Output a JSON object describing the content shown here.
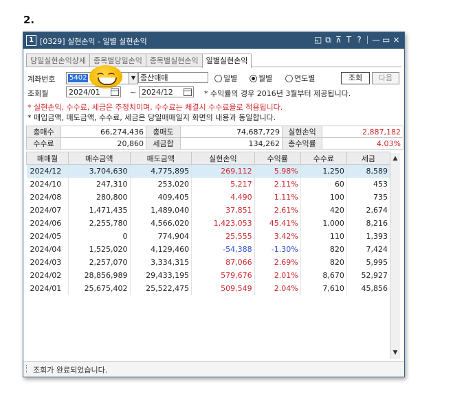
{
  "step_label": "2.",
  "window": {
    "number": "1",
    "title": "[0329] 실현손익 - 일별 실현손익",
    "icons": [
      "restore-icon",
      "copy-icon",
      "pin-icon",
      "font-icon",
      "help-icon",
      "minimize-icon",
      "maximize-icon",
      "close-icon"
    ],
    "icon_glyphs": {
      "restore": "◱",
      "copy": "⧉",
      "pin": "⊼",
      "font": "T",
      "help": "?",
      "minimize": "—",
      "maximize": "▭",
      "close": "×"
    }
  },
  "tabs": [
    {
      "label": "당일실현손익상세",
      "active": false
    },
    {
      "label": "종목별당일손익",
      "active": false
    },
    {
      "label": "종목별실현손익",
      "active": false
    },
    {
      "label": "일별실현손익",
      "active": true
    }
  ],
  "form": {
    "account_label": "계좌번호",
    "account_value": "5402",
    "account_name": "종산매매",
    "radios": [
      {
        "label": "일별",
        "checked": false
      },
      {
        "label": "월별",
        "checked": true
      },
      {
        "label": "연도별",
        "checked": false
      }
    ],
    "search_button": "조회",
    "next_button": "다음",
    "period_label": "조회월",
    "from_date": "2024/01",
    "tilde": "~",
    "to_date": "2024/12",
    "period_note": "* 수익률의 경우 2016년 3월부터 제공됩니다."
  },
  "notices": [
    "* 실현손익, 수수료, 세금은 추정치이며, 수수료는 체결시 수수료율로 적용됩니다.",
    "* 매입금액, 매도금액, 수수료, 세금은 당일매매일지 화면의 내용과 동일합니다."
  ],
  "summary": {
    "row1": [
      {
        "k": "총매수",
        "v": "66,274,436"
      },
      {
        "k": "총매도",
        "v": "74,687,729"
      },
      {
        "k": "실현손익",
        "v": "2,887,182",
        "color": "red"
      }
    ],
    "row2": [
      {
        "k": "수수료",
        "v": "20,860"
      },
      {
        "k": "세금합",
        "v": "134,262"
      },
      {
        "k": "총수익률",
        "v": "4.03%",
        "color": "red"
      }
    ]
  },
  "table": {
    "headers": [
      "매매월",
      "매수금액",
      "매도금액",
      "실현손익",
      "수익률",
      "수수료",
      "세금"
    ],
    "rows": [
      {
        "month": "2024/12",
        "buy": "3,704,630",
        "sell": "4,775,895",
        "pnl": "269,112",
        "rate": "5.98%",
        "fee": "1,250",
        "tax": "8,589",
        "sign": "pos",
        "selected": true
      },
      {
        "month": "2024/10",
        "buy": "247,310",
        "sell": "253,020",
        "pnl": "5,217",
        "rate": "2.11%",
        "fee": "60",
        "tax": "453",
        "sign": "pos"
      },
      {
        "month": "2024/08",
        "buy": "280,800",
        "sell": "409,405",
        "pnl": "4,490",
        "rate": "1.11%",
        "fee": "100",
        "tax": "735",
        "sign": "pos"
      },
      {
        "month": "2024/07",
        "buy": "1,471,435",
        "sell": "1,489,040",
        "pnl": "37,851",
        "rate": "2.61%",
        "fee": "420",
        "tax": "2,674",
        "sign": "pos"
      },
      {
        "month": "2024/06",
        "buy": "2,255,780",
        "sell": "4,566,020",
        "pnl": "1,423,053",
        "rate": "45.41%",
        "fee": "1,000",
        "tax": "8,216",
        "sign": "pos"
      },
      {
        "month": "2024/05",
        "buy": "0",
        "sell": "774,904",
        "pnl": "25,555",
        "rate": "3.42%",
        "fee": "110",
        "tax": "1,393",
        "sign": "pos"
      },
      {
        "month": "2024/04",
        "buy": "1,525,020",
        "sell": "4,129,460",
        "pnl": "-54,388",
        "rate": "-1.30%",
        "fee": "820",
        "tax": "7,424",
        "sign": "neg"
      },
      {
        "month": "2024/03",
        "buy": "2,257,070",
        "sell": "3,334,315",
        "pnl": "87,066",
        "rate": "2.69%",
        "fee": "820",
        "tax": "5,995",
        "sign": "pos"
      },
      {
        "month": "2024/02",
        "buy": "28,856,989",
        "sell": "29,433,195",
        "pnl": "579,676",
        "rate": "2.01%",
        "fee": "8,670",
        "tax": "52,927",
        "sign": "pos"
      },
      {
        "month": "2024/01",
        "buy": "25,675,402",
        "sell": "25,522,475",
        "pnl": "509,549",
        "rate": "2.04%",
        "fee": "7,610",
        "tax": "45,856",
        "sign": "pos"
      }
    ]
  },
  "status": "조회가 완료되었습니다.",
  "colors": {
    "titlebar": "#2f5375",
    "positive": "#d0262b",
    "negative": "#2a4fd0",
    "selected_row": "#d8ebf7"
  }
}
